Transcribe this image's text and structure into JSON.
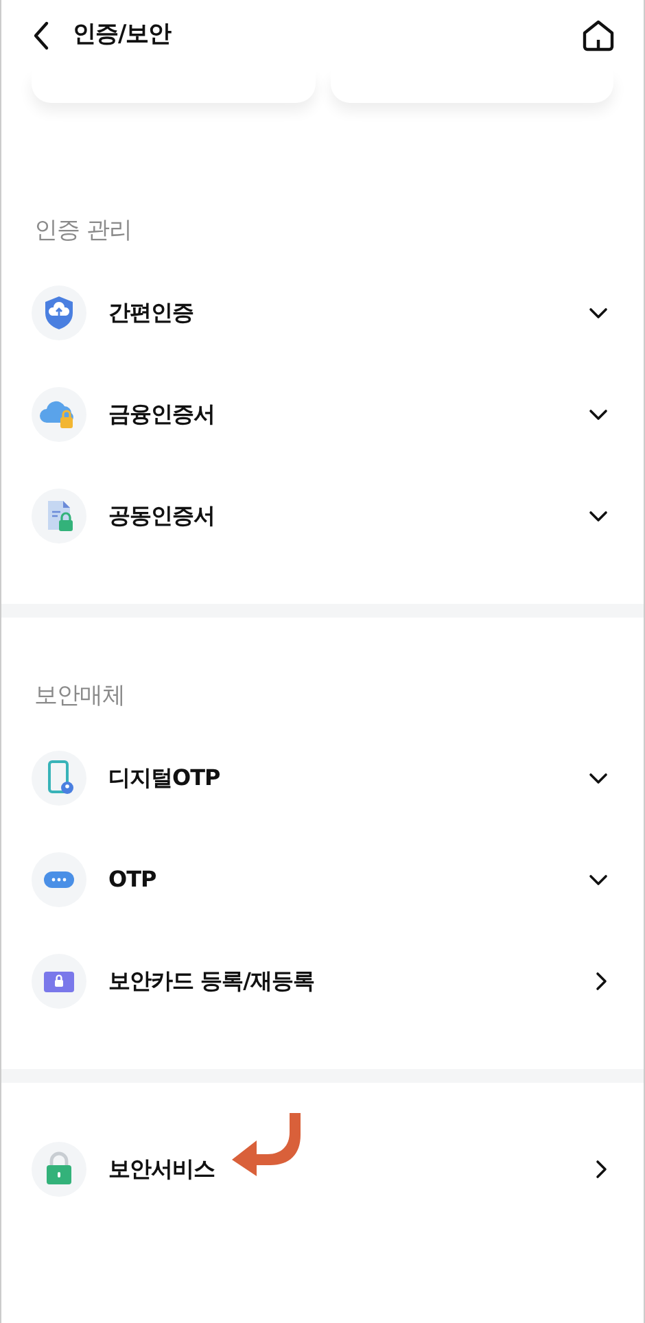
{
  "header": {
    "title": "인증/보안"
  },
  "sections": [
    {
      "title": "인증 관리",
      "items": [
        {
          "label": "간편인증",
          "kind": "expandable"
        },
        {
          "label": "금융인증서",
          "kind": "expandable"
        },
        {
          "label": "공동인증서",
          "kind": "expandable"
        }
      ]
    },
    {
      "title": "보안매체",
      "items": [
        {
          "label": "디지털OTP",
          "kind": "expandable"
        },
        {
          "label": "OTP",
          "kind": "expandable"
        },
        {
          "label": "보안카드 등록/재등록",
          "kind": "link"
        }
      ]
    },
    {
      "items": [
        {
          "label": "보안서비스",
          "kind": "link"
        }
      ]
    }
  ]
}
